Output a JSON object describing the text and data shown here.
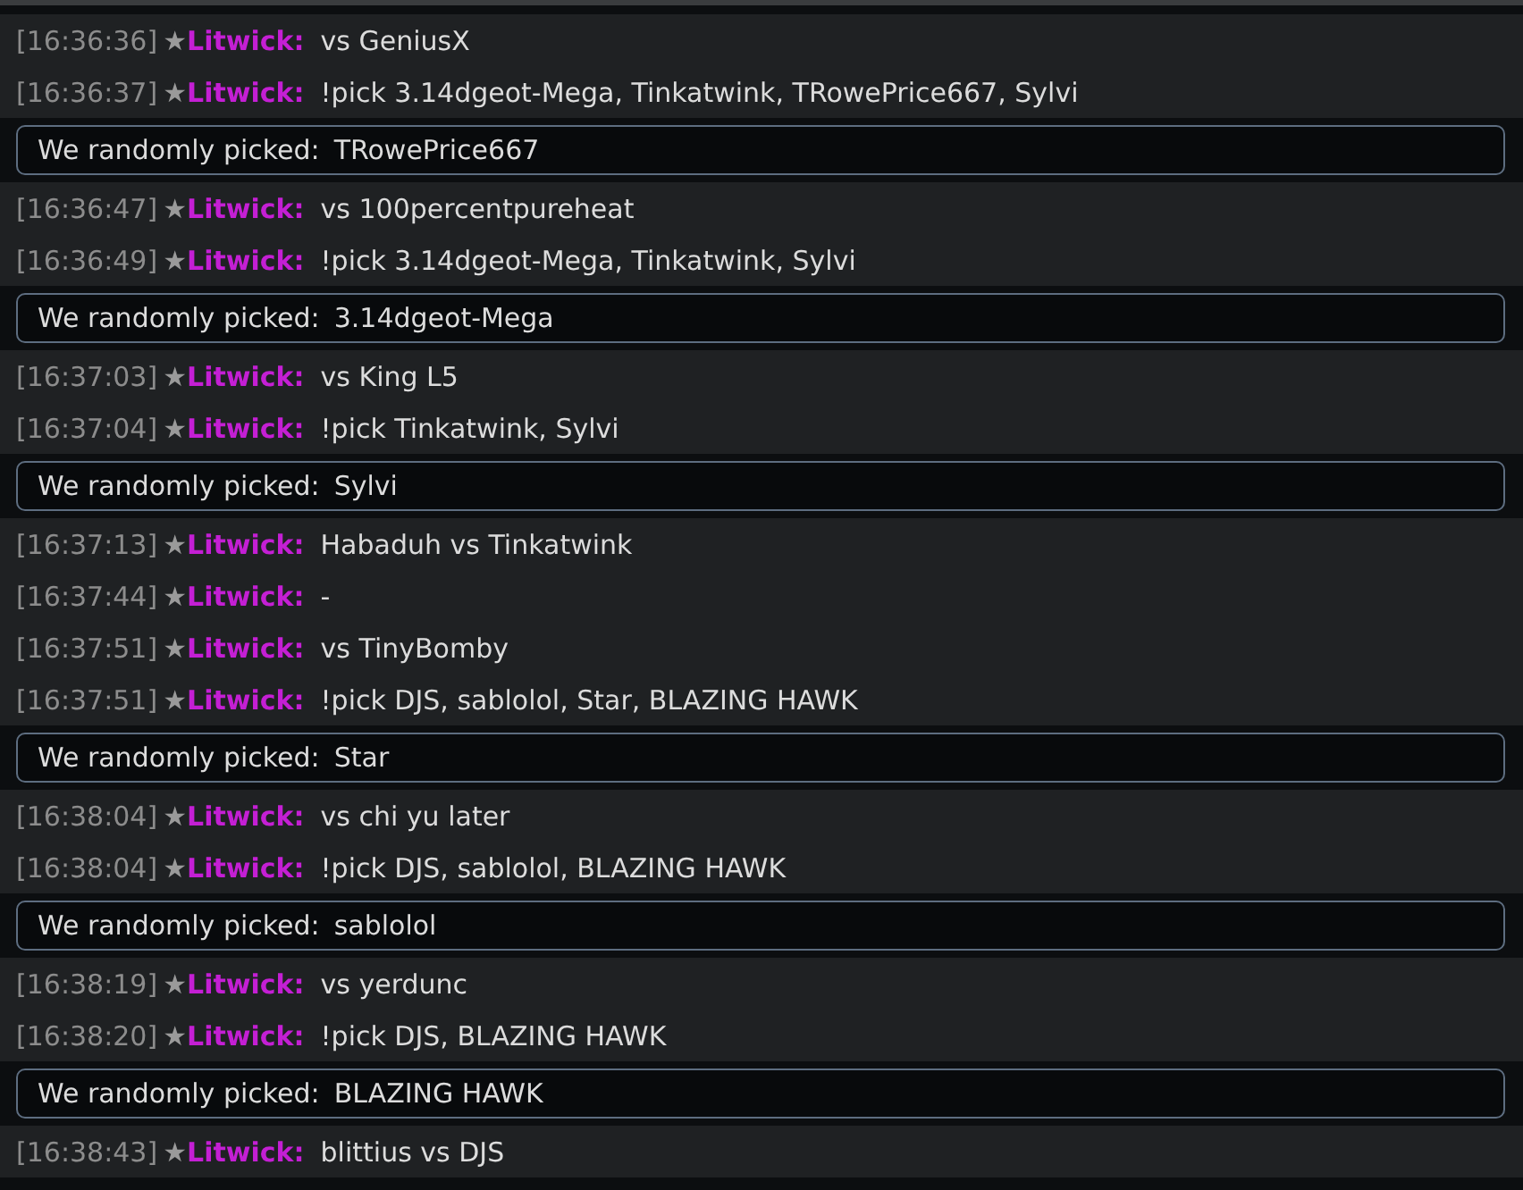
{
  "log": [
    {
      "kind": "chat",
      "messages": [
        {
          "time": "[16:36:36]",
          "rank": "★",
          "user": "Litwick:",
          "text": "vs GeniusX"
        },
        {
          "time": "[16:36:37]",
          "rank": "★",
          "user": "Litwick:",
          "text": "!pick 3.14dgeot-Mega, Tinkatwink, TRowePrice667, Sylvi"
        }
      ]
    },
    {
      "kind": "raw",
      "label": "We randomly picked:",
      "value": "TRowePrice667"
    },
    {
      "kind": "chat",
      "messages": [
        {
          "time": "[16:36:47]",
          "rank": "★",
          "user": "Litwick:",
          "text": "vs 100percentpureheat"
        },
        {
          "time": "[16:36:49]",
          "rank": "★",
          "user": "Litwick:",
          "text": "!pick 3.14dgeot-Mega, Tinkatwink, Sylvi"
        }
      ]
    },
    {
      "kind": "raw",
      "label": "We randomly picked:",
      "value": "3.14dgeot-Mega"
    },
    {
      "kind": "chat",
      "messages": [
        {
          "time": "[16:37:03]",
          "rank": "★",
          "user": "Litwick:",
          "text": "vs King L5"
        },
        {
          "time": "[16:37:04]",
          "rank": "★",
          "user": "Litwick:",
          "text": "!pick Tinkatwink, Sylvi"
        }
      ]
    },
    {
      "kind": "raw",
      "label": "We randomly picked:",
      "value": "Sylvi"
    },
    {
      "kind": "chat",
      "messages": [
        {
          "time": "[16:37:13]",
          "rank": "★",
          "user": "Litwick:",
          "text": "Habaduh vs Tinkatwink"
        },
        {
          "time": "[16:37:44]",
          "rank": "★",
          "user": "Litwick:",
          "text": "-"
        },
        {
          "time": "[16:37:51]",
          "rank": "★",
          "user": "Litwick:",
          "text": "vs TinyBomby"
        },
        {
          "time": "[16:37:51]",
          "rank": "★",
          "user": "Litwick:",
          "text": "!pick DJS, sablolol, Star, BLAZING HAWK"
        }
      ]
    },
    {
      "kind": "raw",
      "label": "We randomly picked:",
      "value": "Star"
    },
    {
      "kind": "chat",
      "messages": [
        {
          "time": "[16:38:04]",
          "rank": "★",
          "user": "Litwick:",
          "text": "vs chi yu later"
        },
        {
          "time": "[16:38:04]",
          "rank": "★",
          "user": "Litwick:",
          "text": "!pick DJS, sablolol, BLAZING HAWK"
        }
      ]
    },
    {
      "kind": "raw",
      "label": "We randomly picked:",
      "value": "sablolol"
    },
    {
      "kind": "chat",
      "messages": [
        {
          "time": "[16:38:19]",
          "rank": "★",
          "user": "Litwick:",
          "text": "vs yerdunc"
        },
        {
          "time": "[16:38:20]",
          "rank": "★",
          "user": "Litwick:",
          "text": "!pick DJS, BLAZING HAWK"
        }
      ]
    },
    {
      "kind": "raw",
      "label": "We randomly picked:",
      "value": "BLAZING HAWK"
    },
    {
      "kind": "chat",
      "messages": [
        {
          "time": "[16:38:43]",
          "rank": "★",
          "user": "Litwick:",
          "text": "blittius vs DJS"
        }
      ]
    }
  ]
}
